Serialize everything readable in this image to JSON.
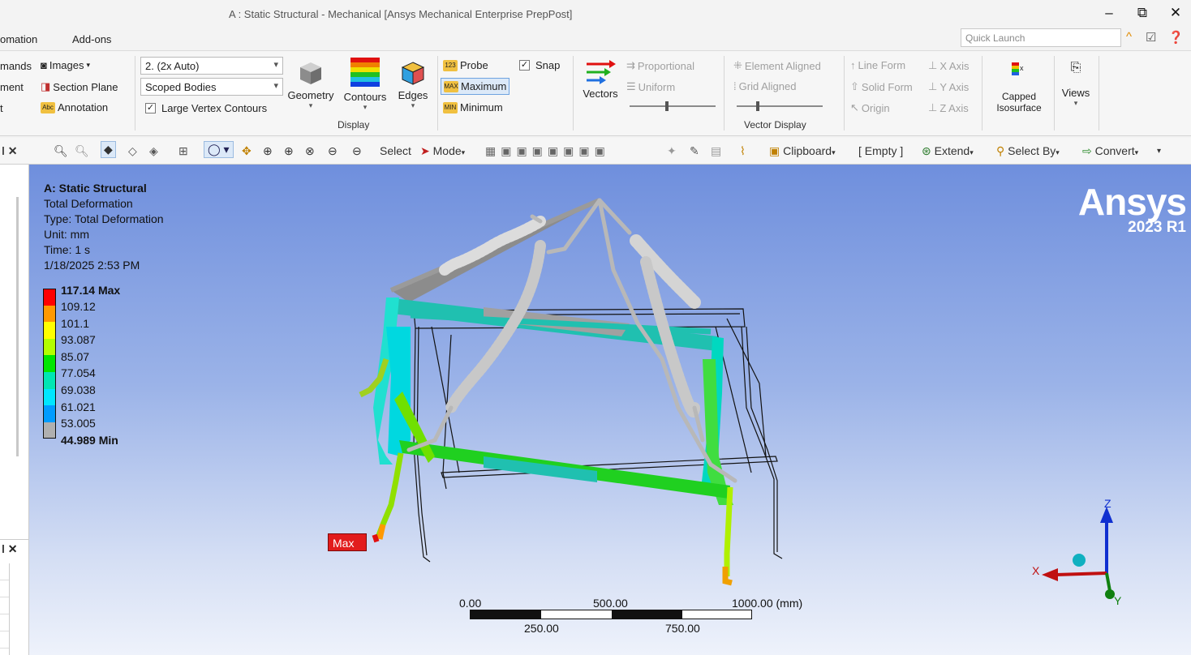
{
  "window": {
    "title": "A : Static Structural - Mechanical [Ansys Mechanical Enterprise PrepPost]",
    "min": "–",
    "restore": "⧉",
    "close": "✕"
  },
  "menu": {
    "items": [
      "omation",
      "Add-ons"
    ]
  },
  "quick_launch": {
    "placeholder": "Quick Launch"
  },
  "ribbon": {
    "col1": [
      "mands",
      "ment",
      "t"
    ],
    "images": "Images",
    "section_plane": "Section Plane",
    "annotation": "Annotation",
    "contour_combo": "2. (2x Auto)",
    "scope_combo": "Scoped Bodies",
    "large_vertex": "Large Vertex Contours",
    "geometry": "Geometry",
    "contours": "Contours",
    "edges": "Edges",
    "display_group": "Display",
    "probe": "Probe",
    "maximum": "Maximum",
    "minimum": "Minimum",
    "snap": "Snap",
    "vectors": "Vectors",
    "proportional": "Proportional",
    "uniform": "Uniform",
    "element_aligned": "Element Aligned",
    "grid_aligned": "Grid Aligned",
    "line_form": "Line Form",
    "solid_form": "Solid Form",
    "origin": "Origin",
    "x_axis": "X Axis",
    "y_axis": "Y Axis",
    "z_axis": "Z Axis",
    "vector_display_group": "Vector Display",
    "capped_l1": "Capped",
    "capped_l2": "Isosurface",
    "views": "Views"
  },
  "toolbar": {
    "select": "Select",
    "mode": "Mode",
    "clipboard": "Clipboard",
    "empty": "[ Empty ]",
    "extend": "Extend",
    "select_by": "Select By",
    "convert": "Convert"
  },
  "result_info": {
    "title": "A: Static Structural",
    "result": "Total Deformation",
    "type": "Type: Total Deformation",
    "unit": "Unit: mm",
    "time": "Time: 1 s",
    "date": "1/18/2025 2:53 PM"
  },
  "legend": {
    "max_label": "117.14 Max",
    "min_label": "44.989 Min",
    "values": [
      "109.12",
      "101.1",
      "93.087",
      "85.07",
      "77.054",
      "69.038",
      "61.021",
      "53.005"
    ],
    "colors": [
      "#ff0000",
      "#ff9900",
      "#ffff00",
      "#b3ff00",
      "#00e600",
      "#00e6b3",
      "#00e6ff",
      "#009cff",
      "#b0b0b0"
    ]
  },
  "logo": {
    "name": "Ansys",
    "version": "2023 R1"
  },
  "max_tag": "Max",
  "scale": {
    "l0": "0.00",
    "l500": "500.00",
    "l1000": "1000.00 (mm)",
    "l250": "250.00",
    "l750": "750.00"
  },
  "triad": {
    "x": "X",
    "y": "Y",
    "z": "Z"
  }
}
